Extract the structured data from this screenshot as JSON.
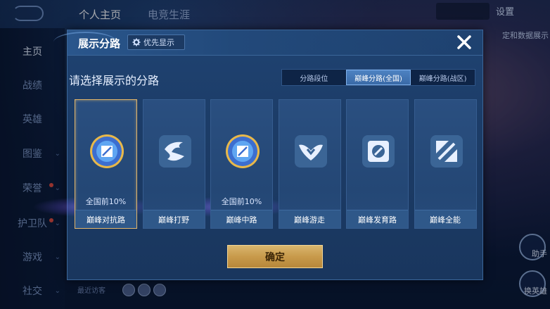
{
  "background": {
    "top_tabs": [
      "个人主页",
      "电竞生涯"
    ],
    "settings_label": "设置",
    "right_partial_text": "定和数据展示",
    "sidebar_items": [
      "主页",
      "战绩",
      "英雄",
      "图鉴",
      "荣誉",
      "护卫队",
      "游戏",
      "社交"
    ],
    "recent_visitors_label": "最近访客",
    "right_buttons": [
      "助手",
      "换英雄"
    ]
  },
  "modal": {
    "title": "展示分路",
    "priority_label": "优先显示",
    "subtitle": "请选择展示的分路",
    "segments": [
      "分路段位",
      "巅峰分路(全国)",
      "巅峰分路(战区)"
    ],
    "active_segment": "巅峰分路(全国)",
    "cards": [
      {
        "label": "巅峰对抗路",
        "rank": "全国前10%",
        "emblem": "lane-top-badge-icon",
        "selected": true
      },
      {
        "label": "巅峰打野",
        "rank": "",
        "emblem": "jungle-icon",
        "selected": false
      },
      {
        "label": "巅峰中路",
        "rank": "全国前10%",
        "emblem": "lane-mid-badge-icon",
        "selected": false
      },
      {
        "label": "巅峰游走",
        "rank": "",
        "emblem": "roam-icon",
        "selected": false
      },
      {
        "label": "巅峰发育路",
        "rank": "",
        "emblem": "farm-lane-icon",
        "selected": false
      },
      {
        "label": "巅峰全能",
        "rank": "",
        "emblem": "all-round-icon",
        "selected": false
      }
    ],
    "confirm_label": "确定"
  },
  "colors": {
    "modal_bg": "#1f4372",
    "accent_gold": "#d9b66e",
    "selected_border": "#e3b66a",
    "segment_active": "#4d82c2"
  }
}
